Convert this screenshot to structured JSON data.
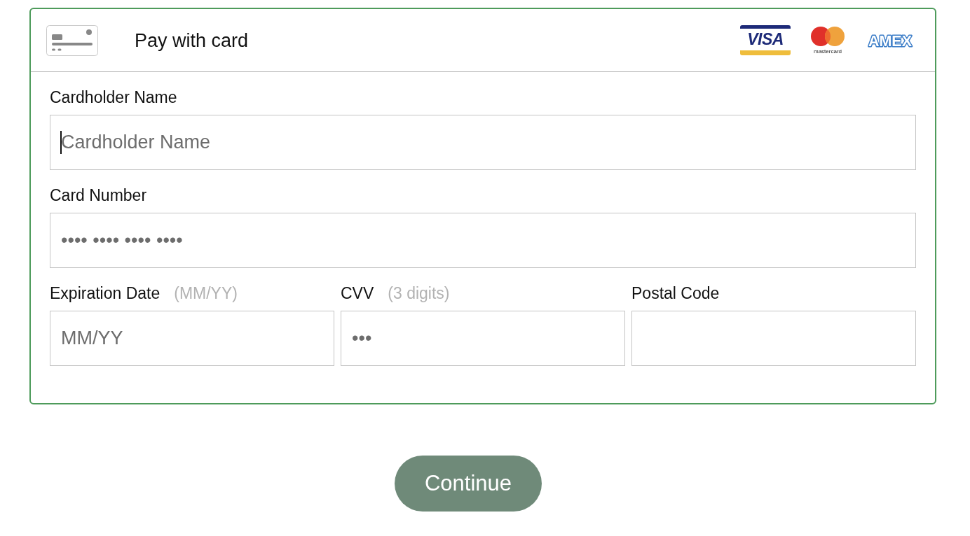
{
  "header": {
    "title": "Pay with card",
    "card_brands": [
      {
        "kind": "visa",
        "label": "VISA"
      },
      {
        "kind": "mastercard",
        "label": "mastercard"
      },
      {
        "kind": "amex",
        "label": "AMEX"
      }
    ]
  },
  "rows": [
    [
      {
        "label": "Cardholder Name",
        "placeholder": "Cardholder Name",
        "focused": true
      }
    ],
    [
      {
        "label": "Card Number",
        "placeholder": "•••• •••• •••• ••••",
        "focused": false
      }
    ],
    [
      {
        "label": "Expiration Date",
        "hint": "(MM/YY)",
        "placeholder": "MM/YY",
        "focused": false
      },
      {
        "label": "CVV",
        "hint": "(3 digits)",
        "placeholder": "•••",
        "focused": false
      },
      {
        "label": "Postal Code",
        "focused": false
      }
    ]
  ],
  "continue_button": {
    "label": "Continue"
  }
}
